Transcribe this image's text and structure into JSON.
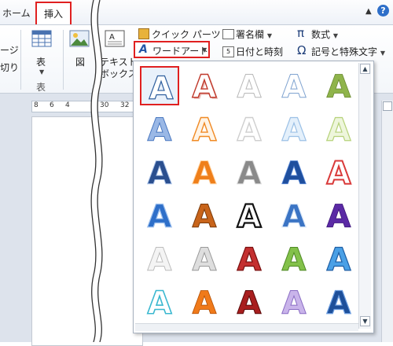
{
  "tabs": {
    "home": "ホーム",
    "insert": "挿入"
  },
  "ribbon": {
    "page_break_fragment": "ージ",
    "page_break_fragment2": "切り",
    "table_label": "表",
    "table_group": "表",
    "picture_label": "図",
    "textbox_line1": "テキスト",
    "textbox_line2": "ボックス",
    "quick_parts": "クイック パーツ",
    "wordart": "ワードアート",
    "signature_line": "署名欄",
    "date_time": "日付と時刻",
    "equation": "数式",
    "symbols": "記号と特殊文字"
  },
  "ruler": {
    "ticks": [
      "8",
      "6",
      "4",
      "30",
      "32"
    ]
  },
  "gallery": {
    "letter": "A",
    "selected_index": 0,
    "styles": [
      [
        "outline-blue",
        "red-shadow",
        "white-outline",
        "white-blue",
        "green-olive"
      ],
      [
        "blue-gradient",
        "orange-glow",
        "white-soft",
        "lightblue-soft",
        "lightgreen-soft"
      ],
      [
        "navy-bevel",
        "orange-bevel",
        "gray-metal",
        "blue-fill",
        "red-outline"
      ],
      [
        "blue-solid",
        "orange-chrome",
        "black-white",
        "blue-reflect",
        "purple-reflect"
      ],
      [
        "silver-light",
        "silver-gray",
        "red-3d",
        "green-3d",
        "blue-3d"
      ],
      [
        "cyan-outline",
        "orange-solid",
        "red-dark",
        "lavender",
        "blue-deep"
      ]
    ]
  },
  "colors": {
    "highlight_border": "#e02020",
    "ribbon_bg": "#f3f6fa",
    "doc_bg": "#dde3ec"
  }
}
